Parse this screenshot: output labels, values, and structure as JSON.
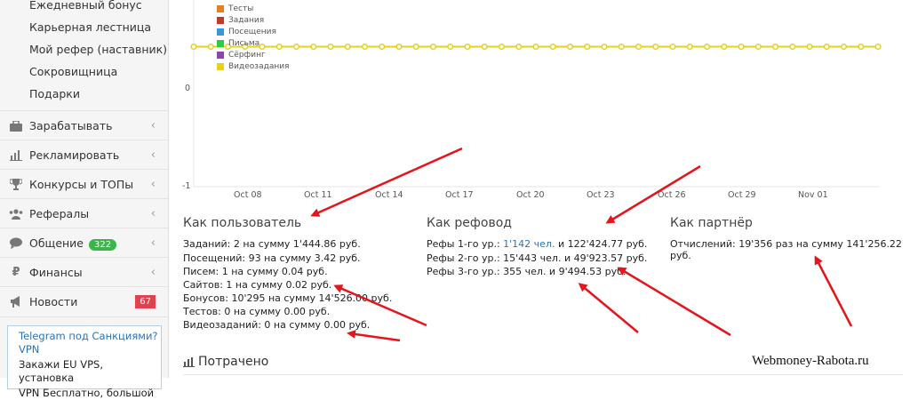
{
  "sidebar": {
    "sub_items": [
      "Ежедневный бонус",
      "Карьерная лестница",
      "Мой рефер (наставник)",
      "Сокровищница",
      "Подарки"
    ],
    "menu": [
      {
        "label": "Зарабатывать",
        "icon": "briefcase-icon"
      },
      {
        "label": "Рекламировать",
        "icon": "bar-chart-icon"
      },
      {
        "label": "Конкурсы и ТОПы",
        "icon": "trophy-icon"
      },
      {
        "label": "Рефералы",
        "icon": "users-icon"
      },
      {
        "label": "Общение",
        "icon": "comments-icon",
        "badge": "322"
      },
      {
        "label": "Финансы",
        "icon": "ruble-icon"
      },
      {
        "label": "Новости",
        "icon": "bullhorn-icon",
        "badge": "67"
      }
    ],
    "promo": {
      "link": "Telegram под Санкциями? VPN",
      "line1": "Закажи EU VPS, установка",
      "line2": "VPN Бесплатно, большой"
    }
  },
  "chart_data": {
    "type": "line",
    "series": [
      {
        "name": "Тесты",
        "color": "#e67e22",
        "values": [
          0,
          0,
          0,
          0,
          0,
          0,
          0,
          0,
          0,
          0,
          0,
          0,
          0,
          0,
          0,
          0,
          0,
          0,
          0,
          0,
          0,
          0,
          0,
          0,
          0,
          0,
          0,
          0,
          0,
          0,
          0,
          0,
          0,
          0,
          0,
          0,
          0,
          0,
          0,
          0,
          0
        ]
      },
      {
        "name": "Задания",
        "color": "#c0392b",
        "values": [
          0,
          0,
          0,
          0,
          0,
          0,
          0,
          0,
          0,
          0,
          0,
          0,
          0,
          0,
          0,
          0,
          0,
          0,
          0,
          0,
          0,
          0,
          0,
          0,
          0,
          0,
          0,
          0,
          0,
          0,
          0,
          0,
          0,
          0,
          0,
          0,
          0,
          0,
          0,
          0,
          0
        ]
      },
      {
        "name": "Посещения",
        "color": "#3498db",
        "values": [
          0,
          0,
          0,
          0,
          0,
          0,
          0,
          0,
          0,
          0,
          0,
          0,
          0,
          0,
          0,
          0,
          0,
          0,
          0,
          0,
          0,
          0,
          0,
          0,
          0,
          0,
          0,
          0,
          0,
          0,
          0,
          0,
          0,
          0,
          0,
          0,
          0,
          0,
          0,
          0,
          0
        ]
      },
      {
        "name": "Письма",
        "color": "#2ecc40",
        "values": [
          0,
          0,
          0,
          0,
          0,
          0,
          0,
          0,
          0,
          0,
          0,
          0,
          0,
          0,
          0,
          0,
          0,
          0,
          0,
          0,
          0,
          0,
          0,
          0,
          0,
          0,
          0,
          0,
          0,
          0,
          0,
          0,
          0,
          0,
          0,
          0,
          0,
          0,
          0,
          0,
          0
        ]
      },
      {
        "name": "Сёрфинг",
        "color": "#8e44ad",
        "values": [
          0,
          0,
          0,
          0,
          0,
          0,
          0,
          0,
          0,
          0,
          0,
          0,
          0,
          0,
          0,
          0,
          0,
          0,
          0,
          0,
          0,
          0,
          0,
          0,
          0,
          0,
          0,
          0,
          0,
          0,
          0,
          0,
          0,
          0,
          0,
          0,
          0,
          0,
          0,
          0,
          0
        ]
      },
      {
        "name": "Видеозадания",
        "color": "#e6d020",
        "values": [
          0,
          0,
          0,
          0,
          0,
          0,
          0,
          0,
          0,
          0,
          0,
          0,
          0,
          0,
          0,
          0,
          0,
          0,
          0,
          0,
          0,
          0,
          0,
          0,
          0,
          0,
          0,
          0,
          0,
          0,
          0,
          0,
          0,
          0,
          0,
          0,
          0,
          0,
          0,
          0,
          0
        ]
      }
    ],
    "x_tick_labels": [
      "Oct 08",
      "Oct 11",
      "Oct 14",
      "Oct 17",
      "Oct 20",
      "Oct 23",
      "Oct 26",
      "Oct 29",
      "Nov 01"
    ],
    "y_tick_labels": [
      "0",
      "-1"
    ],
    "ylim": [
      -1,
      1
    ],
    "point_count": 41,
    "line_color": "#e6d020"
  },
  "stats": {
    "user": {
      "title": "Как пользователь",
      "lines": [
        "Заданий: 2 на сумму 1'444.86 руб.",
        "Посещений: 93 на сумму 3.42 руб.",
        "Писем: 1 на сумму 0.04 руб.",
        "Сайтов: 1 на сумму 0.02 руб.",
        "Бонусов: 10'295 на сумму 14'526.00 руб.",
        "Тестов: 0 на сумму 0.00 руб.",
        "Видеозаданий: 0 на сумму 0.00 руб."
      ]
    },
    "referrer": {
      "title": "Как рефовод",
      "line1_prefix": "Рефы 1-го ур.:",
      "line1_link": "1'142 чел.",
      "line1_suffix": "и 122'424.77 руб.",
      "line2": "Рефы 2-го ур.: 15'443 чел. и 49'923.57 руб.",
      "line3": "Рефы 3-го ур.: 355 чел. и 9'494.53 руб."
    },
    "partner": {
      "title": "Как партнёр",
      "line1": "Отчислений: 19'356 раз на сумму 141'256.22 руб."
    }
  },
  "spent_section": {
    "title": "Потрачено",
    "icon": "bar-chart-icon"
  },
  "watermark": "Webmoney-Rabota.ru",
  "annotation_color": "#e8141c"
}
